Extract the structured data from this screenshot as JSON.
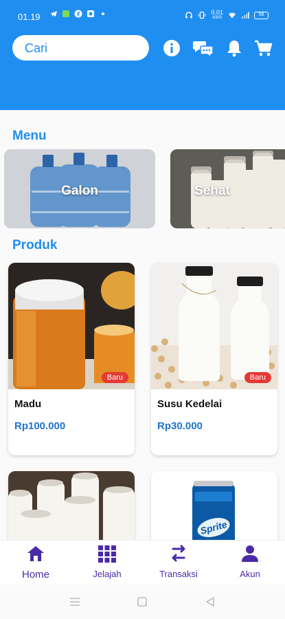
{
  "status": {
    "time": "01.19",
    "net_speed_top": "0.01",
    "net_speed_unit": "KB/S",
    "battery": "58"
  },
  "header": {
    "search_placeholder": "Cari",
    "icons": [
      "info-icon",
      "chat-icon",
      "bell-icon",
      "cart-icon"
    ],
    "color": "#1f8ef1"
  },
  "menu": {
    "title": "Menu",
    "items": [
      {
        "label": "Galon"
      },
      {
        "label": "Sehat"
      }
    ]
  },
  "produk": {
    "title": "Produk",
    "items": [
      {
        "name": "Madu",
        "price": "Rp100.000",
        "badge": "Baru"
      },
      {
        "name": "Susu Kedelai",
        "price": "Rp30.000",
        "badge": "Baru"
      },
      {
        "name": "",
        "price": "",
        "badge": ""
      },
      {
        "name": "",
        "price": "",
        "badge": ""
      }
    ]
  },
  "nav": {
    "items": [
      {
        "label": "Home",
        "icon": "home-icon",
        "active": true
      },
      {
        "label": "Jelajah",
        "icon": "grid-icon",
        "active": false
      },
      {
        "label": "Transaksi",
        "icon": "transfer-icon",
        "active": false
      },
      {
        "label": "Akun",
        "icon": "account-icon",
        "active": false
      }
    ],
    "accent": "#4a2aa8"
  }
}
